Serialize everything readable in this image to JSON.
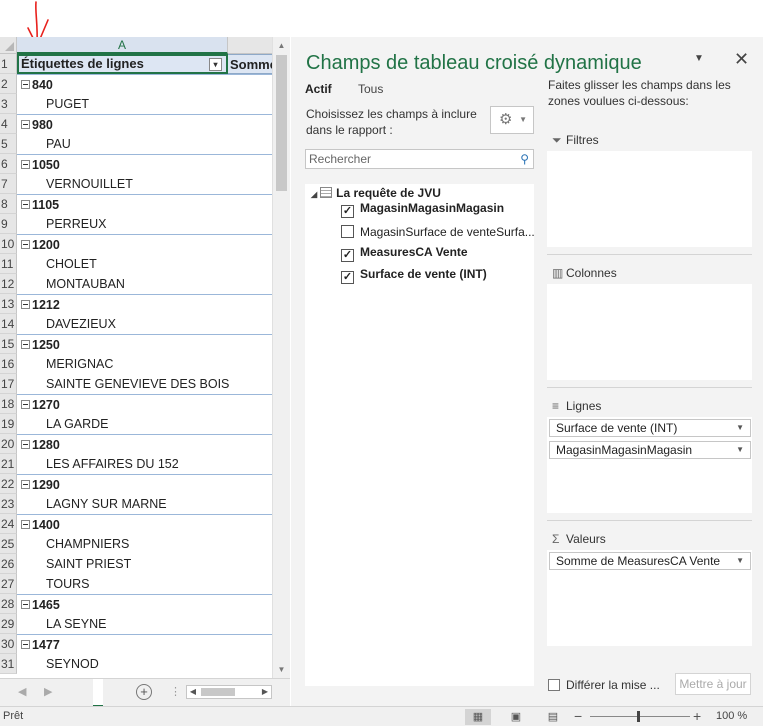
{
  "sheet": {
    "column_a": "A",
    "header_a": "Étiquettes de lignes",
    "header_b": "Somme",
    "rows": [
      {
        "n": "2",
        "text": "840",
        "kind": "group"
      },
      {
        "n": "3",
        "text": "PUGET",
        "kind": "child"
      },
      {
        "n": "4",
        "text": "980",
        "kind": "group"
      },
      {
        "n": "5",
        "text": "PAU",
        "kind": "child"
      },
      {
        "n": "6",
        "text": "1050",
        "kind": "group"
      },
      {
        "n": "7",
        "text": "VERNOUILLET",
        "kind": "child"
      },
      {
        "n": "8",
        "text": "1105",
        "kind": "group"
      },
      {
        "n": "9",
        "text": "PERREUX",
        "kind": "child"
      },
      {
        "n": "10",
        "text": "1200",
        "kind": "group"
      },
      {
        "n": "11",
        "text": "CHOLET",
        "kind": "child"
      },
      {
        "n": "12",
        "text": "MONTAUBAN",
        "kind": "child"
      },
      {
        "n": "13",
        "text": "1212",
        "kind": "group"
      },
      {
        "n": "14",
        "text": "DAVEZIEUX",
        "kind": "child"
      },
      {
        "n": "15",
        "text": "1250",
        "kind": "group"
      },
      {
        "n": "16",
        "text": "MERIGNAC",
        "kind": "child"
      },
      {
        "n": "17",
        "text": "SAINTE GENEVIEVE DES BOIS",
        "kind": "child"
      },
      {
        "n": "18",
        "text": "1270",
        "kind": "group"
      },
      {
        "n": "19",
        "text": "LA GARDE",
        "kind": "child"
      },
      {
        "n": "20",
        "text": "1280",
        "kind": "group"
      },
      {
        "n": "21",
        "text": "LES AFFAIRES DU 152",
        "kind": "child"
      },
      {
        "n": "22",
        "text": "1290",
        "kind": "group"
      },
      {
        "n": "23",
        "text": "LAGNY SUR MARNE",
        "kind": "child"
      },
      {
        "n": "24",
        "text": "1400",
        "kind": "group"
      },
      {
        "n": "25",
        "text": "CHAMPNIERS",
        "kind": "child"
      },
      {
        "n": "26",
        "text": "SAINT PRIEST",
        "kind": "child"
      },
      {
        "n": "27",
        "text": "TOURS",
        "kind": "child"
      },
      {
        "n": "28",
        "text": "1465",
        "kind": "group"
      },
      {
        "n": "29",
        "text": "LA SEYNE",
        "kind": "child"
      },
      {
        "n": "30",
        "text": "1477",
        "kind": "group"
      },
      {
        "n": "31",
        "text": "SEYNOD",
        "kind": "child"
      }
    ]
  },
  "pane": {
    "title": "Champs de tableau croisé dynamique",
    "tab_active": "Actif",
    "tab_all": "Tous",
    "choose_text": "Choisissez les champs à inclure dans le rapport :",
    "search_placeholder": "Rechercher",
    "table_name": "La requête de JVU",
    "fields": [
      {
        "label": "MagasinMagasinMagasin",
        "checked": true
      },
      {
        "label": "MagasinSurface de venteSurfa...",
        "checked": false
      },
      {
        "label": "MeasuresCA Vente",
        "checked": true
      },
      {
        "label": "Surface de vente (INT)",
        "checked": true
      }
    ],
    "drag_hint": "Faites glisser les champs dans les zones voulues ci-dessous:",
    "areas": {
      "filters": "Filtres",
      "columns": "Colonnes",
      "rows": "Lignes",
      "values": "Valeurs"
    },
    "row_fields": [
      "Surface de vente (INT)",
      "MagasinMagasinMagasin"
    ],
    "value_fields": [
      "Somme de MeasuresCA Vente"
    ],
    "defer_label": "Différer la mise ...",
    "update_button": "Mettre à jour"
  },
  "status": {
    "ready": "Prêt",
    "zoom": "100 %"
  },
  "colors": {
    "accent": "#217346",
    "annotation": "#e8211d"
  }
}
